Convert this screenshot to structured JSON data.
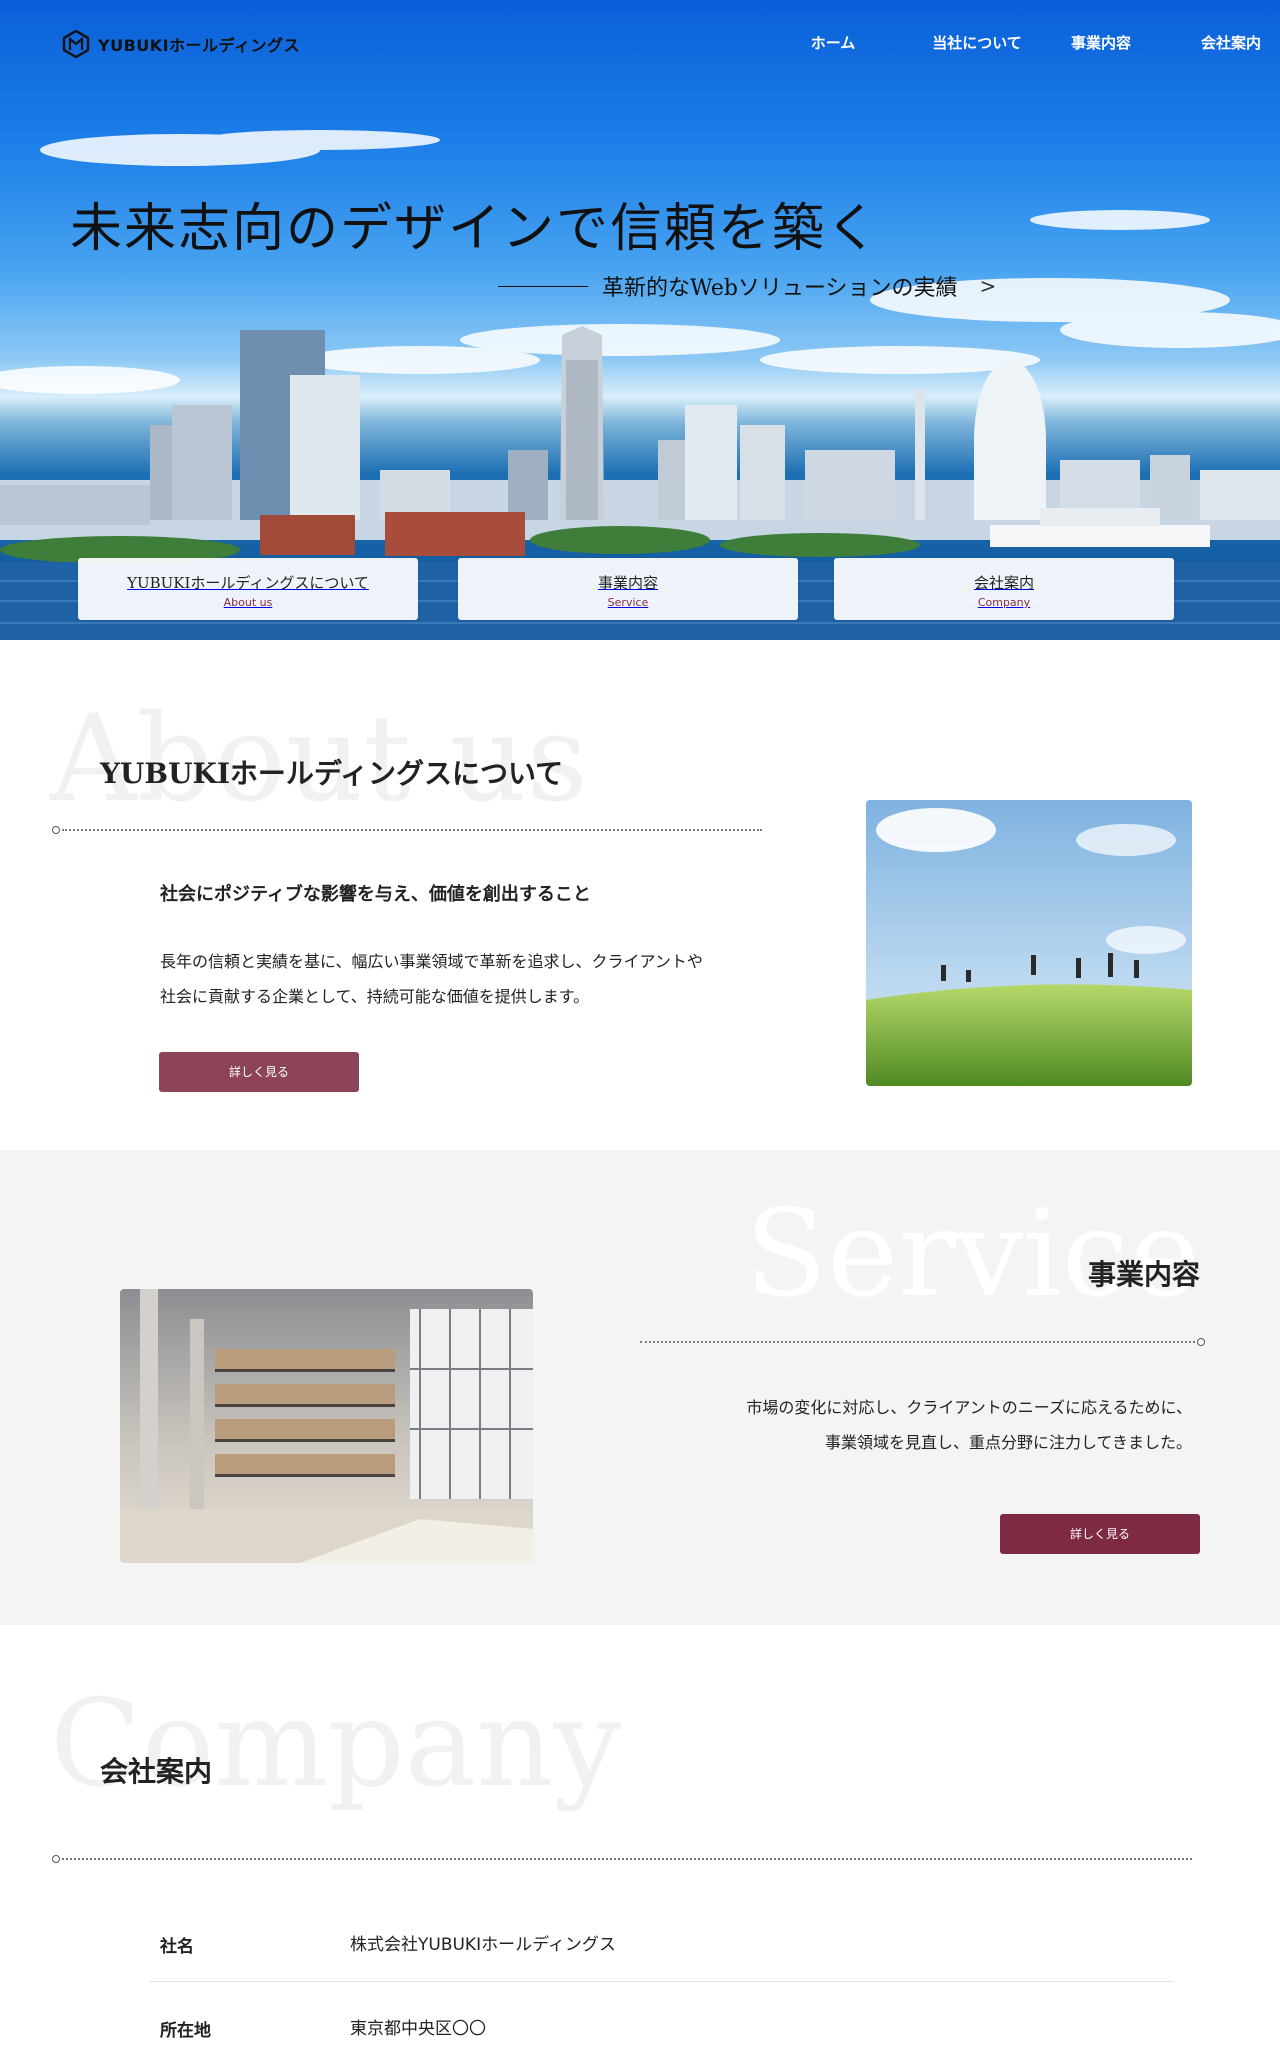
{
  "header": {
    "logo_text": "YUBUKIホールディングス",
    "nav": [
      "ホーム",
      "当社について",
      "事業内容",
      "会社案内"
    ]
  },
  "hero": {
    "title": "未来志向のデザインで信頼を築く",
    "subtitle": "革新的なWebソリューションの実績",
    "arrow": ">",
    "cards": [
      {
        "title": "YUBUKIホールディングスについて",
        "sub": "About us"
      },
      {
        "title": "事業内容",
        "sub": "Service"
      },
      {
        "title": "会社案内",
        "sub": "Company"
      }
    ]
  },
  "about": {
    "ghost": "About us",
    "title": "YUBUKIホールディングスについて",
    "lead": "社会にポジティブな影響を与え、価値を創出すること",
    "body_line1": "長年の信頼と実績を基に、幅広い事業領域で革新を追求し、クライアントや",
    "body_line2": "社会に貢献する企業として、持続可能な価値を提供します。",
    "button": "詳しく見る"
  },
  "service": {
    "ghost": "Service",
    "title": "事業内容",
    "body_line1": "市場の変化に対応し、クライアントのニーズに応えるために、",
    "body_line2": "事業領域を見直し、重点分野に注力してきました。",
    "button": "詳しく見る"
  },
  "company": {
    "ghost": "Company",
    "title": "会社案内",
    "rows": [
      {
        "key": "社名",
        "value": "株式会社YUBUKIホールディングス"
      },
      {
        "key": "所在地",
        "value": "東京都中央区〇〇"
      }
    ]
  },
  "colors": {
    "accent": "#8c4456",
    "accent_dark": "#7d2a42",
    "card_sub": "#8b2a45",
    "section_gray": "#f4f4f4"
  }
}
